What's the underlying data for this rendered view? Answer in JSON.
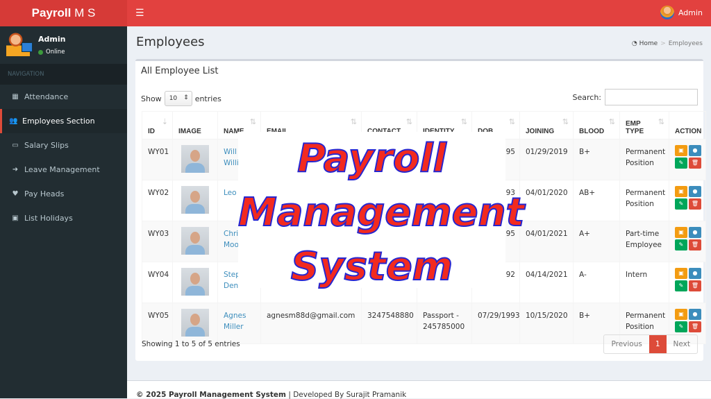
{
  "header": {
    "logo_bold": "Payroll",
    "logo_light": " M S",
    "user": "Admin",
    "menu_icon": "hamburger-icon"
  },
  "sidebar": {
    "user": "Admin",
    "status": "Online",
    "nav_header": "NAVIGATION",
    "items": [
      {
        "label": "Attendance",
        "icon": "calendar-icon"
      },
      {
        "label": "Employees Section",
        "icon": "users-icon",
        "active": true
      },
      {
        "label": "Salary Slips",
        "icon": "money-icon"
      },
      {
        "label": "Leave Management",
        "icon": "sign-out-icon"
      },
      {
        "label": "Pay Heads",
        "icon": "heart-icon"
      },
      {
        "label": "List Holidays",
        "icon": "calendar-check-icon"
      }
    ]
  },
  "page": {
    "title": "Employees",
    "breadcrumb": [
      "Home",
      "Employees"
    ]
  },
  "box": {
    "title": "All Employee List",
    "show": "Show",
    "entries_value": "10",
    "entries": "entries",
    "search_label": "Search:",
    "search_value": "",
    "info": "Showing 1 to 5 of 5 entries",
    "pagination": {
      "prev": "Previous",
      "current": "1",
      "next": "Next"
    }
  },
  "table": {
    "headers": [
      "ID",
      "IMAGE",
      "NAME",
      "EMAIL",
      "CONTACT",
      "IDENTITY",
      "DOB",
      "JOINING",
      "BLOOD",
      "EMP TYPE",
      "ACTION"
    ],
    "rows": [
      {
        "id": "WY01",
        "name1": "Will",
        "name2": "Willi",
        "email": "",
        "contact": "",
        "identity1": "",
        "identity2": "",
        "dob": "95",
        "joining": "01/29/2019",
        "blood": "B+",
        "type1": "Permanent",
        "type2": "Position"
      },
      {
        "id": "WY02",
        "name1": "Leo A",
        "name2": "",
        "email": "",
        "contact": "",
        "identity1": "",
        "identity2": "",
        "dob": "93",
        "joining": "04/01/2020",
        "blood": "AB+",
        "type1": "Permanent",
        "type2": "Position"
      },
      {
        "id": "WY03",
        "name1": "Chris",
        "name2": "Moor",
        "email": "",
        "contact": "",
        "identity1": "",
        "identity2": "",
        "dob": "95",
        "joining": "04/01/2021",
        "blood": "A+",
        "type1": "Part-time",
        "type2": "Employee"
      },
      {
        "id": "WY04",
        "name1": "Step",
        "name2": "Denn",
        "email": "",
        "contact": "",
        "identity1": "",
        "identity2": "",
        "dob": "92",
        "joining": "04/14/2021",
        "blood": "A-",
        "type1": "Intern",
        "type2": ""
      },
      {
        "id": "WY05",
        "name1": "Agnes",
        "name2": "Miller",
        "email": "agnesm88d@gmail.com",
        "contact": "3247548880",
        "identity1": "Passport -",
        "identity2": "245785000",
        "dob": "07/29/1993",
        "joining": "10/15/2020",
        "blood": "B+",
        "type1": "Permanent",
        "type2": "Position"
      }
    ]
  },
  "overlay": {
    "line1": "Payroll",
    "line2": "Management",
    "line3": "System"
  },
  "footer": {
    "copyright": "© 2025 Payroll Management System",
    "developer": " | Developed By Surajit Pramanik"
  },
  "colors": {
    "header": "#e2413f",
    "sidebar": "#222d32",
    "link": "#3c8dbc",
    "orange": "#f39c12",
    "blue": "#3c8dbc",
    "green": "#00a65a",
    "red": "#dd4b39"
  }
}
